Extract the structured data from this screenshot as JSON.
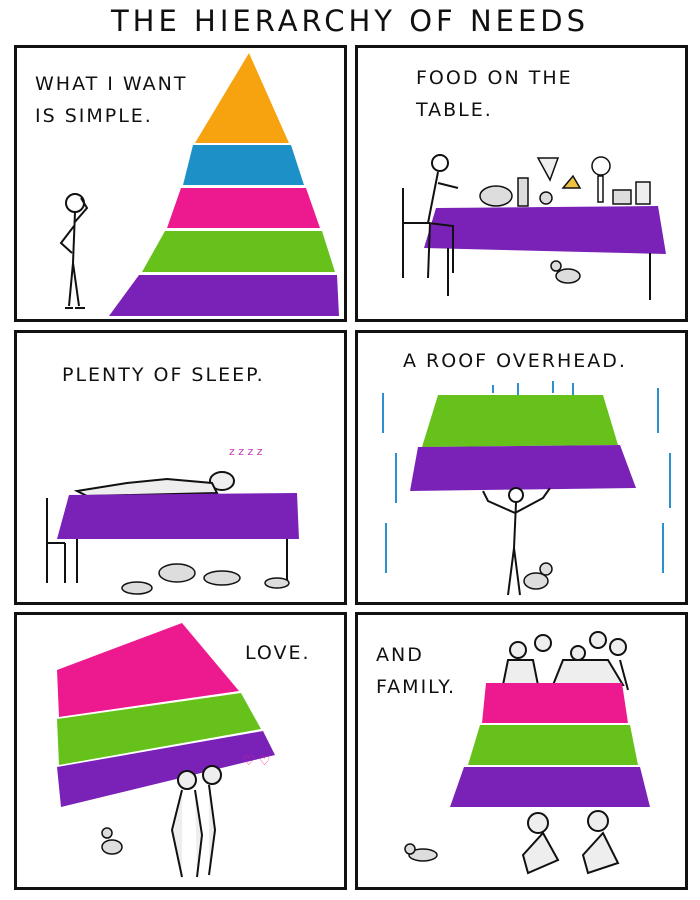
{
  "title": "THE HIERARCHY OF NEEDS",
  "panels": [
    {
      "caption": "WHAT I WANT\nIS SIMPLE."
    },
    {
      "caption": "FOOD ON THE\nTABLE."
    },
    {
      "caption": "PLENTY OF SLEEP."
    },
    {
      "caption": "A ROOF OVERHEAD."
    },
    {
      "caption": "LOVE."
    },
    {
      "caption": "AND\nFAMILY."
    }
  ],
  "colors": {
    "orange": "#f7a20f",
    "blue": "#1e90c8",
    "pink": "#ec1a8e",
    "green": "#66c21a",
    "purple": "#7a22b8",
    "rain": "#2d8fd0",
    "ink": "#111111"
  }
}
